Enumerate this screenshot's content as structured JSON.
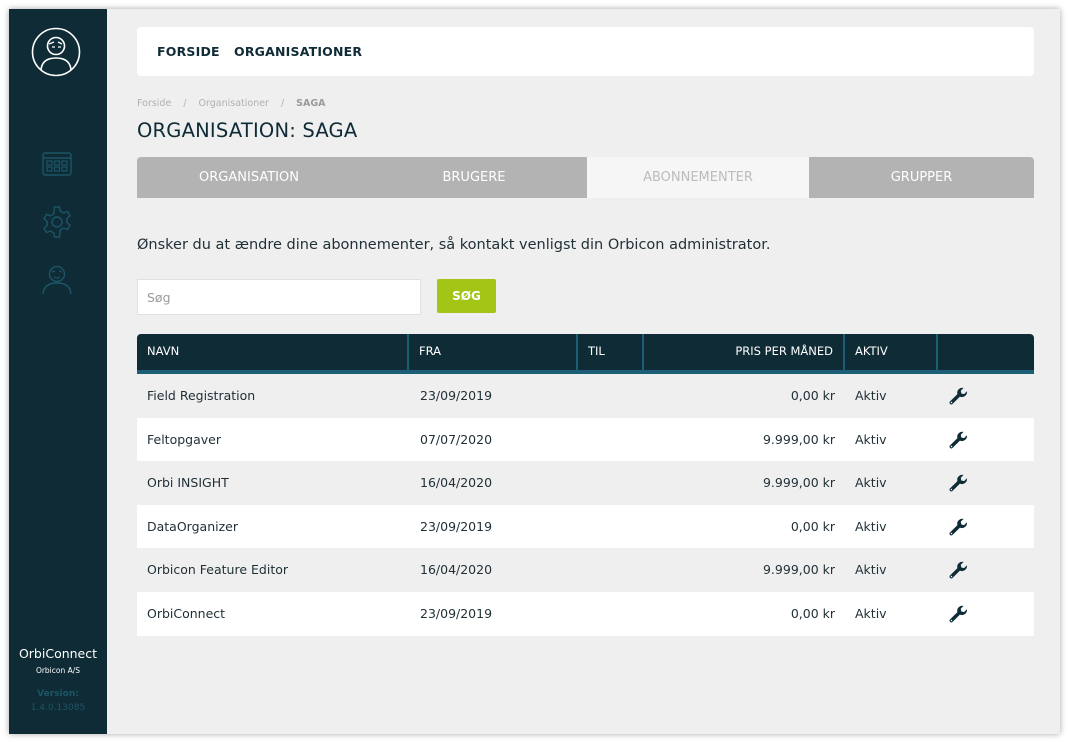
{
  "sidebar": {
    "app_name": "OrbiConnect",
    "company": "Orbicon A/S",
    "version_label": "Version:",
    "version": "1.4.0.13085",
    "icons": [
      "user-avatar-icon",
      "apps-grid-icon",
      "gear-icon",
      "user-icon"
    ]
  },
  "topnav": {
    "forside": "FORSIDE",
    "organisationer": "ORGANISATIONER"
  },
  "breadcrumb": {
    "items": [
      "Forside",
      "Organisationer",
      "SAGA"
    ],
    "separator": "/"
  },
  "page_title": "ORGANISATION: SAGA",
  "tabs": [
    {
      "label": "ORGANISATION",
      "active": false
    },
    {
      "label": "BRUGERE",
      "active": false
    },
    {
      "label": "ABONNEMENTER",
      "active": true
    },
    {
      "label": "GRUPPER",
      "active": false
    }
  ],
  "info_text": "Ønsker du at ændre dine abonnementer, så kontakt venligst din Orbicon administrator.",
  "search": {
    "placeholder": "Søg",
    "value": "",
    "button_label": "SØG"
  },
  "table": {
    "headers": [
      "NAVN",
      "FRA",
      "TIL",
      "PRIS PER MÅNED",
      "AKTIV",
      ""
    ],
    "rows": [
      {
        "navn": "Field Registration",
        "fra": "23/09/2019",
        "til": "",
        "pris": "0,00 kr",
        "aktiv": "Aktiv",
        "icon": "wrench-icon"
      },
      {
        "navn": "Feltopgaver",
        "fra": "07/07/2020",
        "til": "",
        "pris": "9.999,00 kr",
        "aktiv": "Aktiv",
        "icon": "wrench-icon"
      },
      {
        "navn": "Orbi INSIGHT",
        "fra": "16/04/2020",
        "til": "",
        "pris": "9.999,00 kr",
        "aktiv": "Aktiv",
        "icon": "wrench-icon"
      },
      {
        "navn": "DataOrganizer",
        "fra": "23/09/2019",
        "til": "",
        "pris": "0,00 kr",
        "aktiv": "Aktiv",
        "icon": "wrench-icon"
      },
      {
        "navn": "Orbicon Feature Editor",
        "fra": "16/04/2020",
        "til": "",
        "pris": "9.999,00 kr",
        "aktiv": "Aktiv",
        "icon": "wrench-icon"
      },
      {
        "navn": "OrbiConnect",
        "fra": "23/09/2019",
        "til": "",
        "pris": "0,00 kr",
        "aktiv": "Aktiv",
        "icon": "wrench-icon"
      }
    ]
  },
  "colors": {
    "sidebar_bg": "#0f2b36",
    "accent_green": "#a2c516",
    "tab_inactive": "#b3b3b3",
    "header_border": "#1b5e75",
    "page_bg": "#efefef"
  }
}
